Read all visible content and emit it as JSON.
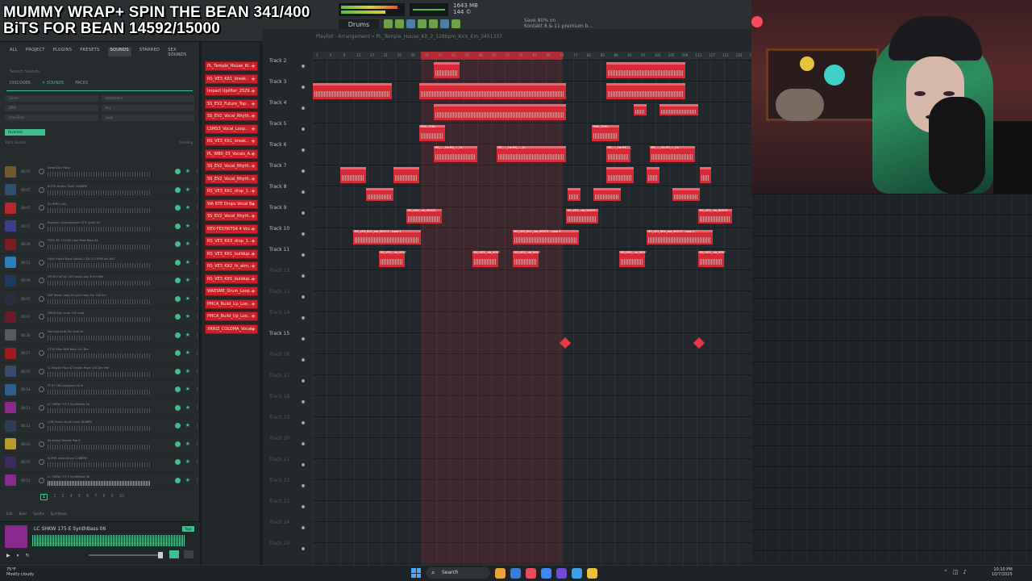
{
  "overlay": {
    "line1": "MUMMY WRAP+ SPIN THE BEAN 341/400",
    "line2": "BiTS FOR BEAN 14592/15000"
  },
  "toolbar": {
    "pattern": "Drums",
    "stats_line1": "1643 MB",
    "stats_line2": "144 ©",
    "hint_line1": "Save 80% on",
    "hint_line2": "Kontakt 8 & 11 premium b..."
  },
  "browser": {
    "tabs": [
      "ALL",
      "PROJECT",
      "PLUGINS",
      "PRESETS",
      "SOUNDS",
      "STARRED",
      "SEX SOUNDS"
    ],
    "active_tab": "SOUNDS",
    "search_placeholder": "Search Sounds",
    "subtabs": [
      "DISCOVER",
      "✕ SOUNDS",
      "PACKS"
    ],
    "filters": [
      "Genre",
      "Instrument",
      "BPM",
      "Key",
      "One-Shot",
      "Loop"
    ],
    "favorites_label": "Favorites",
    "result_count": "1044 Sounds",
    "sort_label": "Trending",
    "items": [
      {
        "dur": "00:07",
        "name": "Deep Kick Flash",
        "bpm": "",
        "thumb": "#6e5a2e"
      },
      {
        "dur": "00:07",
        "name": "KOTM Vocals Chant 128BPM",
        "bpm": "",
        "thumb": "#2f4f6e"
      },
      {
        "dur": "00:07",
        "name": "SO RPM 1 Kix",
        "bpm": "",
        "thumb": "#b8262e"
      },
      {
        "dur": "00:17",
        "name": "Euphoric Hypermodern STX Synth 01",
        "bpm": "",
        "thumb": "#3b3f8a"
      },
      {
        "dur": "00:29",
        "name": "FCR2 SD 134 N0 Loop Peak Bass 04",
        "bpm": "",
        "thumb": "#7a1e24"
      },
      {
        "dur": "00:12",
        "name": "Ultra Future Rave Vocals 2 SD 127 BPM Am HAT",
        "bpm": "",
        "thumb": "#2c7fb8"
      },
      {
        "dur": "00:09",
        "name": "DP SD Full Up 128 Vocal Loop B Em Mer",
        "bpm": "",
        "thumb": "#1f3a5e"
      },
      {
        "dur": "00:07",
        "name": "DAT Music Loop Kf synth loop Em 128 Em",
        "bpm": "",
        "thumb": "#2a2d3e"
      },
      {
        "dur": "00:07",
        "name": "DBGA Kick Loop 128 Long",
        "bpm": "",
        "thumb": "#6b1a2a"
      },
      {
        "dur": "00:36",
        "name": "Morning birds tec texture",
        "bpm": "",
        "thumb": "#5a5a5a"
      },
      {
        "dur": "00:17",
        "name": "ST 87 Disc BSB Bass 142 Dm",
        "bpm": "",
        "thumb": "#a01a22"
      },
      {
        "dur": "00:07",
        "name": "CL Maxiar Rise 42 Vocals Maze 126 Dm Mer",
        "bpm": "",
        "thumb": "#3a4a6a"
      },
      {
        "dur": "00:14",
        "name": "FT 87 180 polyglass KICK",
        "bpm": "",
        "thumb": "#2f5e8a"
      },
      {
        "dur": "00:13",
        "name": "LC SHKW 175 E SynthBass 04",
        "bpm": "",
        "thumb": "#8a2a8e"
      },
      {
        "dur": "00:13",
        "name": "USB Ocean Drum Loop 160BPM",
        "bpm": "",
        "thumb": "#2a3d52"
      },
      {
        "dur": "00:01",
        "name": "Bs Jersey Female Pop it",
        "bpm": "",
        "thumb": "#b89a2e"
      },
      {
        "dur": "00:07",
        "name": "SUPER Vocal Shout 128BPM",
        "bpm": "",
        "thumb": "#3d2a5e"
      },
      {
        "dur": "00:13",
        "name": "LC SHKW 175 E SynthBass 06",
        "bpm": "",
        "thumb": "#8a2a8e"
      }
    ],
    "pages": [
      "1",
      "2",
      "3",
      "4",
      "5",
      "6",
      "7",
      "8",
      "9",
      "10"
    ],
    "current_page": "1",
    "tags": [
      "Edit",
      "Bass",
      "Synths",
      "Synthbass"
    ],
    "preview_name": "LC SHKW 175 E SynthBass 06",
    "preview_tag": "Tags",
    "preview_controls": [
      "▶",
      "⏸",
      "↻"
    ]
  },
  "picker": {
    "items": [
      "PL_Temple_House_Ki..",
      "RS_VE3_Kit1_break..",
      "Impact Uplifter_2529..",
      "SS_EV2_Future_Top..",
      "SS_EV2_Vocal_Rhyth..",
      "LSMS3_Vocal_Loop..",
      "RS_VE3_Kit1_break..",
      "PL_WB0_03_Vocals_A..",
      "SS_EV2_Vocal_Rhyth..",
      "SS_EV2_Vocal_Rhyth..",
      "RS_VE3_Kit1_drop_1..",
      "WA BTE Drops Vocal B..",
      "SS_EV2_Vocal_Rhyth..",
      "REV-FESTKITS4 4 Voc..",
      "RS_VE3_Kit3_drop_1..",
      "RS_VE3_Kit1_buildup..",
      "RS_VE3_Kit2_fx_atm..",
      "RS_VE3_Kit5_buildup..",
      "WAESME_Drum_Loop..",
      "PMCA_Build_Up_Loo..",
      "PMCA_Build_Up_Loo..",
      "XRRIZ_COLOMA_Vocal.."
    ]
  },
  "playlist": {
    "title": "Playlist - Arrangement » PL_Temple_House_Kit_2_128bpm_Kick_Em_3451337",
    "tracks": [
      "Track 2",
      "Track 3",
      "Track 4",
      "Track 5",
      "Track 6",
      "Track 7",
      "Track 8",
      "Track 9",
      "Track 10",
      "Track 11",
      "Track 12",
      "Track 13",
      "Track 14",
      "Track 15",
      "Track 16",
      "Track 17",
      "Track 18",
      "Track 19",
      "Track 20",
      "Track 21",
      "Track 22",
      "Track 23",
      "Track 24",
      "Track 25"
    ],
    "active_track_count": 10,
    "ruler": [
      "1",
      "5",
      "9",
      "13",
      "17",
      "21",
      "25",
      "29",
      "33",
      "37",
      "41",
      "45",
      "49",
      "53",
      "57",
      "61",
      "65",
      "69",
      "73",
      "77",
      "81",
      "85",
      "89",
      "93",
      "97",
      "101",
      "105",
      "109",
      "113",
      "117",
      "121",
      "125",
      "129"
    ],
    "clip_labels": {
      "kit": "RS_VE3_..ds_90973",
      "pmc": "PMC_3761",
      "sss": "RS_..._1ts RS_..._1s",
      "loop": "RS_VE3_Kit1_dro_90973 - Loop 1"
    }
  },
  "taskbar": {
    "temp": "75°F",
    "weather": "Mostly cloudy",
    "search": "Search",
    "time": "10:10 PM",
    "date": "10/7/2025",
    "app_colors": [
      "#e8a33a",
      "#3a7bd5",
      "#e84a5f",
      "#4285f4",
      "#6e4ad5",
      "#3aa0e8",
      "#e8c23a"
    ]
  },
  "colors": {
    "clip": "#d42b36",
    "accent": "#3fbf8d",
    "selection": "#b42a34"
  }
}
